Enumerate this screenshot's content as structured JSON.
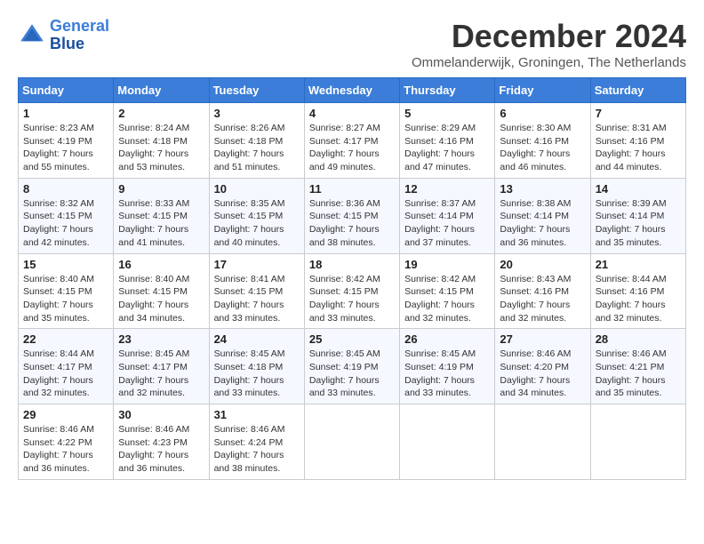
{
  "logo": {
    "line1": "General",
    "line2": "Blue"
  },
  "title": "December 2024",
  "location": "Ommelanderwijk, Groningen, The Netherlands",
  "weekdays": [
    "Sunday",
    "Monday",
    "Tuesday",
    "Wednesday",
    "Thursday",
    "Friday",
    "Saturday"
  ],
  "weeks": [
    [
      {
        "day": "1",
        "sunrise": "Sunrise: 8:23 AM",
        "sunset": "Sunset: 4:19 PM",
        "daylight": "Daylight: 7 hours and 55 minutes."
      },
      {
        "day": "2",
        "sunrise": "Sunrise: 8:24 AM",
        "sunset": "Sunset: 4:18 PM",
        "daylight": "Daylight: 7 hours and 53 minutes."
      },
      {
        "day": "3",
        "sunrise": "Sunrise: 8:26 AM",
        "sunset": "Sunset: 4:18 PM",
        "daylight": "Daylight: 7 hours and 51 minutes."
      },
      {
        "day": "4",
        "sunrise": "Sunrise: 8:27 AM",
        "sunset": "Sunset: 4:17 PM",
        "daylight": "Daylight: 7 hours and 49 minutes."
      },
      {
        "day": "5",
        "sunrise": "Sunrise: 8:29 AM",
        "sunset": "Sunset: 4:16 PM",
        "daylight": "Daylight: 7 hours and 47 minutes."
      },
      {
        "day": "6",
        "sunrise": "Sunrise: 8:30 AM",
        "sunset": "Sunset: 4:16 PM",
        "daylight": "Daylight: 7 hours and 46 minutes."
      },
      {
        "day": "7",
        "sunrise": "Sunrise: 8:31 AM",
        "sunset": "Sunset: 4:16 PM",
        "daylight": "Daylight: 7 hours and 44 minutes."
      }
    ],
    [
      {
        "day": "8",
        "sunrise": "Sunrise: 8:32 AM",
        "sunset": "Sunset: 4:15 PM",
        "daylight": "Daylight: 7 hours and 42 minutes."
      },
      {
        "day": "9",
        "sunrise": "Sunrise: 8:33 AM",
        "sunset": "Sunset: 4:15 PM",
        "daylight": "Daylight: 7 hours and 41 minutes."
      },
      {
        "day": "10",
        "sunrise": "Sunrise: 8:35 AM",
        "sunset": "Sunset: 4:15 PM",
        "daylight": "Daylight: 7 hours and 40 minutes."
      },
      {
        "day": "11",
        "sunrise": "Sunrise: 8:36 AM",
        "sunset": "Sunset: 4:15 PM",
        "daylight": "Daylight: 7 hours and 38 minutes."
      },
      {
        "day": "12",
        "sunrise": "Sunrise: 8:37 AM",
        "sunset": "Sunset: 4:14 PM",
        "daylight": "Daylight: 7 hours and 37 minutes."
      },
      {
        "day": "13",
        "sunrise": "Sunrise: 8:38 AM",
        "sunset": "Sunset: 4:14 PM",
        "daylight": "Daylight: 7 hours and 36 minutes."
      },
      {
        "day": "14",
        "sunrise": "Sunrise: 8:39 AM",
        "sunset": "Sunset: 4:14 PM",
        "daylight": "Daylight: 7 hours and 35 minutes."
      }
    ],
    [
      {
        "day": "15",
        "sunrise": "Sunrise: 8:40 AM",
        "sunset": "Sunset: 4:15 PM",
        "daylight": "Daylight: 7 hours and 35 minutes."
      },
      {
        "day": "16",
        "sunrise": "Sunrise: 8:40 AM",
        "sunset": "Sunset: 4:15 PM",
        "daylight": "Daylight: 7 hours and 34 minutes."
      },
      {
        "day": "17",
        "sunrise": "Sunrise: 8:41 AM",
        "sunset": "Sunset: 4:15 PM",
        "daylight": "Daylight: 7 hours and 33 minutes."
      },
      {
        "day": "18",
        "sunrise": "Sunrise: 8:42 AM",
        "sunset": "Sunset: 4:15 PM",
        "daylight": "Daylight: 7 hours and 33 minutes."
      },
      {
        "day": "19",
        "sunrise": "Sunrise: 8:42 AM",
        "sunset": "Sunset: 4:15 PM",
        "daylight": "Daylight: 7 hours and 32 minutes."
      },
      {
        "day": "20",
        "sunrise": "Sunrise: 8:43 AM",
        "sunset": "Sunset: 4:16 PM",
        "daylight": "Daylight: 7 hours and 32 minutes."
      },
      {
        "day": "21",
        "sunrise": "Sunrise: 8:44 AM",
        "sunset": "Sunset: 4:16 PM",
        "daylight": "Daylight: 7 hours and 32 minutes."
      }
    ],
    [
      {
        "day": "22",
        "sunrise": "Sunrise: 8:44 AM",
        "sunset": "Sunset: 4:17 PM",
        "daylight": "Daylight: 7 hours and 32 minutes."
      },
      {
        "day": "23",
        "sunrise": "Sunrise: 8:45 AM",
        "sunset": "Sunset: 4:17 PM",
        "daylight": "Daylight: 7 hours and 32 minutes."
      },
      {
        "day": "24",
        "sunrise": "Sunrise: 8:45 AM",
        "sunset": "Sunset: 4:18 PM",
        "daylight": "Daylight: 7 hours and 33 minutes."
      },
      {
        "day": "25",
        "sunrise": "Sunrise: 8:45 AM",
        "sunset": "Sunset: 4:19 PM",
        "daylight": "Daylight: 7 hours and 33 minutes."
      },
      {
        "day": "26",
        "sunrise": "Sunrise: 8:45 AM",
        "sunset": "Sunset: 4:19 PM",
        "daylight": "Daylight: 7 hours and 33 minutes."
      },
      {
        "day": "27",
        "sunrise": "Sunrise: 8:46 AM",
        "sunset": "Sunset: 4:20 PM",
        "daylight": "Daylight: 7 hours and 34 minutes."
      },
      {
        "day": "28",
        "sunrise": "Sunrise: 8:46 AM",
        "sunset": "Sunset: 4:21 PM",
        "daylight": "Daylight: 7 hours and 35 minutes."
      }
    ],
    [
      {
        "day": "29",
        "sunrise": "Sunrise: 8:46 AM",
        "sunset": "Sunset: 4:22 PM",
        "daylight": "Daylight: 7 hours and 36 minutes."
      },
      {
        "day": "30",
        "sunrise": "Sunrise: 8:46 AM",
        "sunset": "Sunset: 4:23 PM",
        "daylight": "Daylight: 7 hours and 36 minutes."
      },
      {
        "day": "31",
        "sunrise": "Sunrise: 8:46 AM",
        "sunset": "Sunset: 4:24 PM",
        "daylight": "Daylight: 7 hours and 38 minutes."
      },
      null,
      null,
      null,
      null
    ]
  ]
}
